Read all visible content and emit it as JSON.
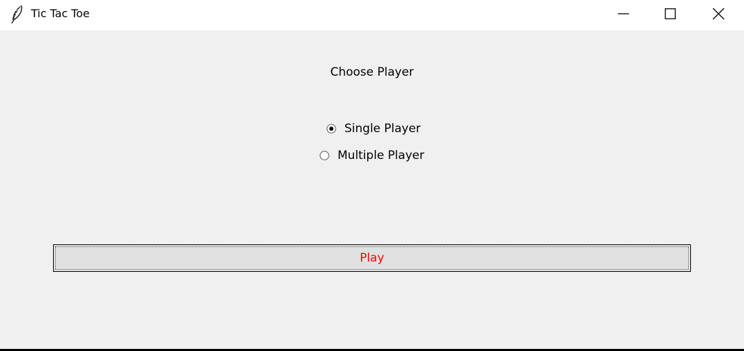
{
  "window": {
    "title": "Tic Tac Toe",
    "app_icon": "feather-icon",
    "controls": {
      "minimize_icon": "minimize-icon",
      "maximize_icon": "maximize-icon",
      "close_icon": "close-icon"
    }
  },
  "main": {
    "heading": "Choose Player",
    "options": [
      {
        "label": "Single Player",
        "selected": true
      },
      {
        "label": "Multiple Player",
        "selected": false
      }
    ],
    "play_button": {
      "label": "Play",
      "text_color": "#ff0000"
    }
  }
}
